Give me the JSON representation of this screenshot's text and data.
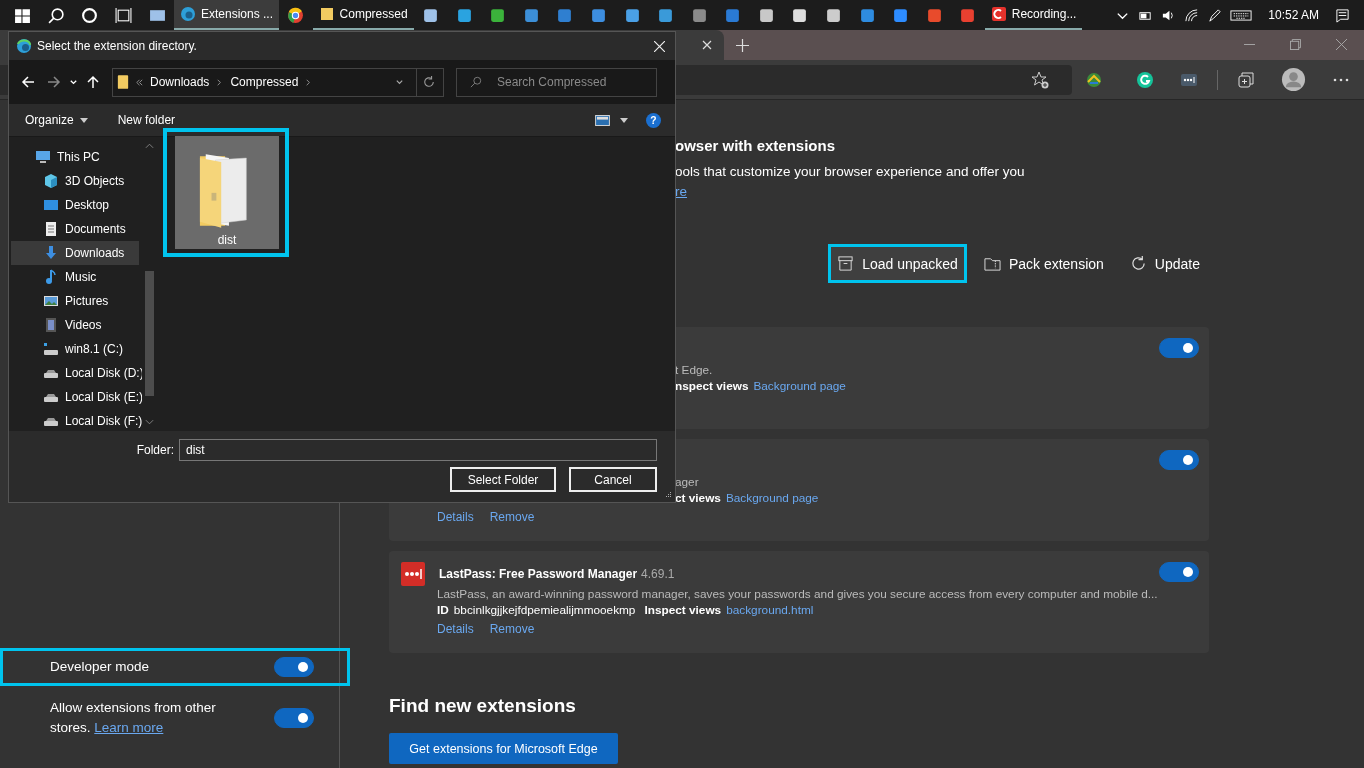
{
  "taskbar": {
    "apps": [
      {
        "label": "Extensions ...",
        "selected": true
      },
      {
        "label": "Compressed",
        "selected": false
      },
      {
        "label": "Recording...",
        "selected": false
      }
    ],
    "clock": "10:52 AM"
  },
  "page": {
    "heading_fragment": "owser with extensions",
    "text_fragment": "ools that customize your browser experience and offer you",
    "link_fragment": "re"
  },
  "actions": [
    {
      "kind": "load",
      "label": "Load unpacked",
      "highlighted": true
    },
    {
      "kind": "pack",
      "label": "Pack extension",
      "highlighted": false
    },
    {
      "kind": "update",
      "label": "Update",
      "highlighted": false
    }
  ],
  "extensions": [
    {
      "description": "t Edge.",
      "meta_label": "nspect views",
      "link": "Background page",
      "enabled": true
    },
    {
      "description": "ager",
      "meta_label": "ct views",
      "link": "Background page",
      "buttons": [
        "Details",
        "Remove"
      ],
      "enabled": true
    },
    {
      "name": "LastPass: Free Password Manager",
      "version": "4.69.1",
      "description": "LastPass, an award-winning password manager, saves your passwords and gives you secure access from every computer and mobile d...",
      "id_label": "ID",
      "id": "bbcinlkgjjkejfdpemiealijmmooekmp",
      "meta_label": "Inspect views",
      "link": "background.html",
      "buttons": [
        "Details",
        "Remove"
      ],
      "enabled": true
    }
  ],
  "settings": [
    {
      "label": "Developer mode",
      "on": true,
      "highlighted": true
    },
    {
      "label": "Allow extensions from other stores.",
      "link": "Learn more",
      "on": true,
      "highlighted": false
    }
  ],
  "find_new": {
    "heading": "Find new extensions",
    "button": "Get extensions for Microsoft Edge"
  },
  "dialog": {
    "title": "Select the extension directory.",
    "path": [
      "Downloads",
      "Compressed"
    ],
    "search_placeholder": "Search Compressed",
    "toolbar": [
      "Organize",
      "New folder"
    ],
    "help": "?",
    "nav": [
      {
        "kind": "pc",
        "label": "This PC",
        "selected": false,
        "children": [
          {
            "kind": "cube",
            "label": "3D Objects",
            "selected": false
          },
          {
            "kind": "desktop",
            "label": "Desktop",
            "selected": false
          },
          {
            "kind": "documents",
            "label": "Documents",
            "selected": false
          },
          {
            "kind": "downloads",
            "label": "Downloads",
            "selected": true
          },
          {
            "kind": "music",
            "label": "Music",
            "selected": false
          },
          {
            "kind": "pictures",
            "label": "Pictures",
            "selected": false
          },
          {
            "kind": "videos",
            "label": "Videos",
            "selected": false
          },
          {
            "kind": "system",
            "label": "win8.1 (C:)",
            "selected": false
          },
          {
            "kind": "disk",
            "label": "Local Disk (D:)",
            "selected": false
          },
          {
            "kind": "disk",
            "label": "Local Disk (E:)",
            "selected": false
          },
          {
            "kind": "disk",
            "label": "Local Disk (F:)",
            "selected": false
          }
        ]
      }
    ],
    "files": [
      {
        "name": "dist",
        "selected": true,
        "highlighted": true
      }
    ],
    "folder_label": "Folder:",
    "folder_value": "dist",
    "buttons": [
      "Select Folder",
      "Cancel"
    ]
  }
}
